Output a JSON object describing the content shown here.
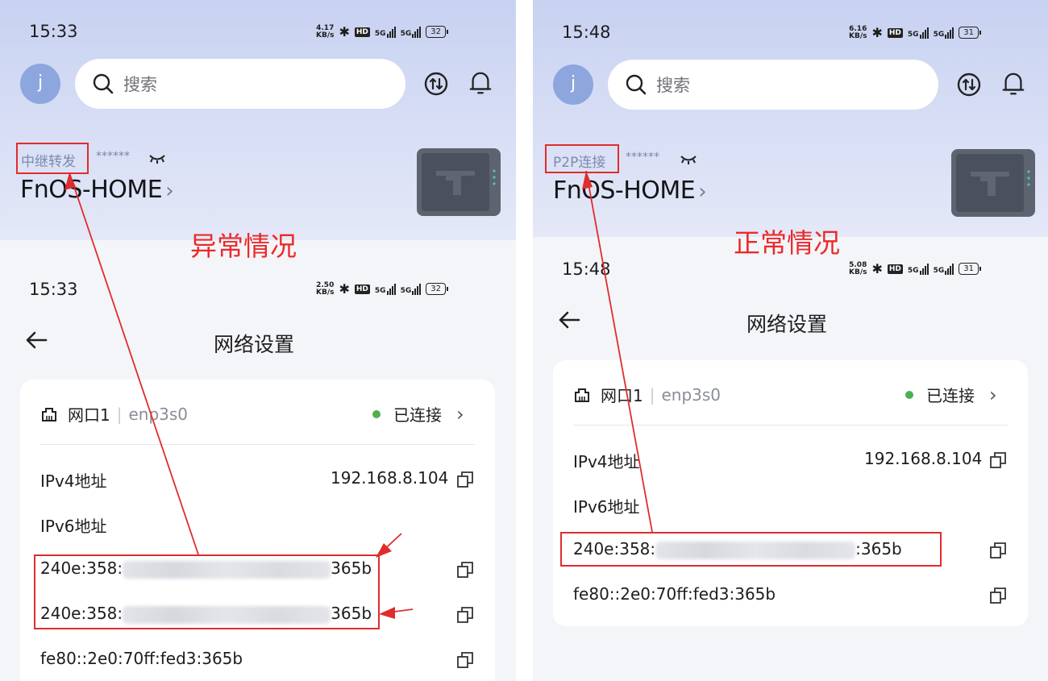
{
  "left": {
    "status_bar": {
      "time": "15:33",
      "speed_top": "4.17",
      "speed_unit": "KB/s",
      "hd": "HD",
      "sig1": "5G",
      "sig2": "5G",
      "battery": "32"
    },
    "avatar": "j",
    "search_placeholder": "搜索",
    "connection_mode": "中继转发",
    "password_mask": "******",
    "device_name": "FnOS-HOME",
    "caption": "异常情况",
    "sub_status_bar": {
      "time": "15:33",
      "speed_top": "2.50",
      "speed_unit": "KB/s",
      "hd": "HD",
      "sig1": "5G",
      "sig2": "5G",
      "battery": "32"
    },
    "page_title": "网络设置",
    "port_label": "网口1",
    "port_device": "enp3s0",
    "port_status": "已连接",
    "ipv4_label": "IPv4地址",
    "ipv4_value": "192.168.8.104",
    "ipv6_label": "IPv6地址",
    "ipv6": [
      {
        "prefix": "240e:358:",
        "suffix": "365b"
      },
      {
        "prefix": "240e:358:",
        "suffix": "365b"
      }
    ],
    "link_local": "fe80::2e0:70ff:fed3:365b"
  },
  "right": {
    "status_bar": {
      "time": "15:48",
      "speed_top": "6.16",
      "speed_unit": "KB/s",
      "hd": "HD",
      "sig1": "5G",
      "sig2": "5G",
      "battery": "31"
    },
    "avatar": "j",
    "search_placeholder": "搜索",
    "connection_mode": "P2P连接",
    "password_mask": "******",
    "device_name": "FnOS-HOME",
    "caption": "正常情况",
    "sub_status_bar": {
      "time": "15:48",
      "speed_top": "5.08",
      "speed_unit": "KB/s",
      "hd": "HD",
      "sig1": "5G",
      "sig2": "5G",
      "battery": "31"
    },
    "page_title": "网络设置",
    "port_label": "网口1",
    "port_device": "enp3s0",
    "port_status": "已连接",
    "ipv4_label": "IPv4地址",
    "ipv4_value": "192.168.8.104",
    "ipv6_label": "IPv6地址",
    "ipv6": [
      {
        "prefix": "240e:358:",
        "suffix": ":365b"
      }
    ],
    "link_local": "fe80::2e0:70ff:fed3:365b"
  },
  "colors": {
    "annotation_red": "#e02c2c",
    "status_green": "#4caf50",
    "header_blue": "#c7d2f1"
  },
  "icons": [
    "search-icon",
    "transfer-icon",
    "bell-icon",
    "eye-closed-icon",
    "nas-device-icon",
    "back-arrow-icon",
    "ethernet-port-icon",
    "chevron-right-icon",
    "copy-icon"
  ]
}
